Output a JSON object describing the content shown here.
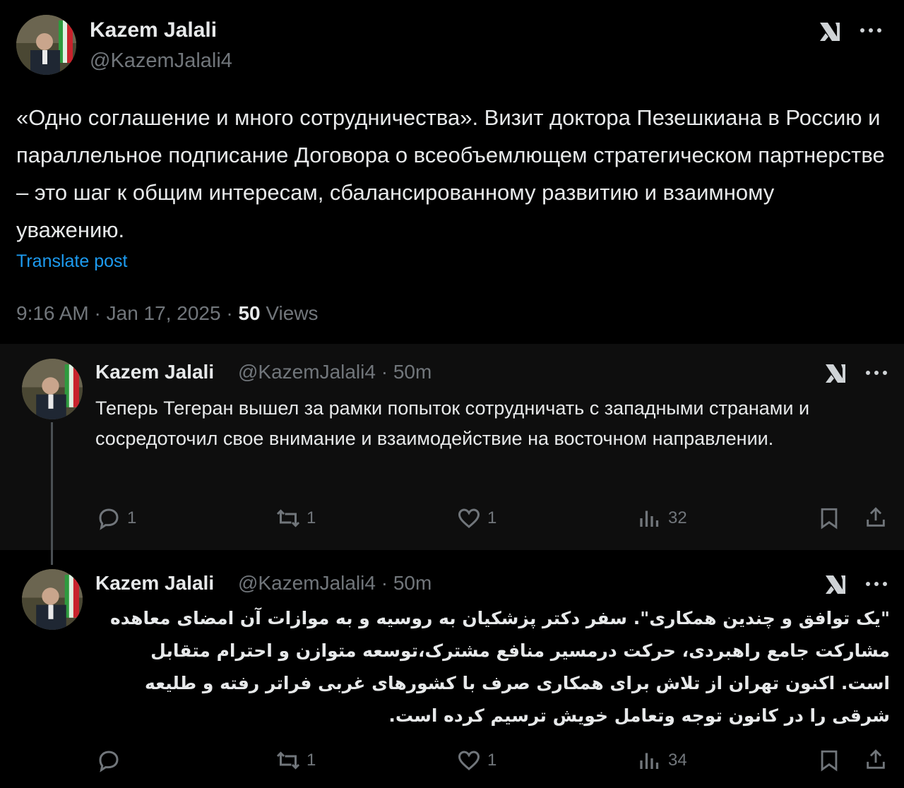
{
  "tweet": {
    "author_name": "Kazem Jalali",
    "author_handle": "@KazemJalali4",
    "text": "«Одно соглашение и много сотрудничества». Визит доктора Пезешкиана в Россию и параллельное подписание Договора о всеобъемлющем стратегическом партнерстве – это шаг к общим интересам, сбалансированному развитию и взаимному уважению.",
    "translate_label": "Translate post",
    "time": "9:16 AM",
    "separator": "·",
    "date": "Jan 17, 2025",
    "views_count": "50",
    "views_label": "Views"
  },
  "replies": [
    {
      "author_name": "Kazem Jalali",
      "author_handle": "@KazemJalali4",
      "age": "· 50m",
      "text": "Теперь Тегеран вышел за рамки попыток сотрудничать с западными странами и сосредоточил свое внимание и взаимодействие на восточном направлении.",
      "reply_count": "1",
      "repost_count": "1",
      "like_count": "1",
      "view_count": "32"
    },
    {
      "author_name": "Kazem Jalali",
      "author_handle": "@KazemJalali4",
      "age": "· 50m",
      "text": "\"یک توافق و چندین همکاری\". سفر دکتر پزشکیان به روسیه و به موازات آن امضای معاهده مشارکت جامع راهبردی، حرکت درمسیر منافع مشترک،توسعه متوازن و احترام متقابل است. اکنون تهران از تلاش برای همکاری صرف با کشورهای غربی فراتر رفته و طلیعه شرقی را در کانون توجه وتعامل خویش ترسیم کرده است.",
      "reply_count": "",
      "repost_count": "1",
      "like_count": "1",
      "view_count": "34"
    }
  ],
  "icons": {
    "grok": "grok-icon",
    "more": "more-icon",
    "reply": "reply-icon",
    "repost": "repost-icon",
    "like": "like-icon",
    "views": "views-icon",
    "bookmark": "bookmark-icon",
    "share": "share-icon"
  },
  "colors": {
    "background": "#000000",
    "reply_background": "#0e0e0e",
    "text": "#e7e9ea",
    "secondary": "#71767b",
    "link": "#1d9bf0"
  }
}
